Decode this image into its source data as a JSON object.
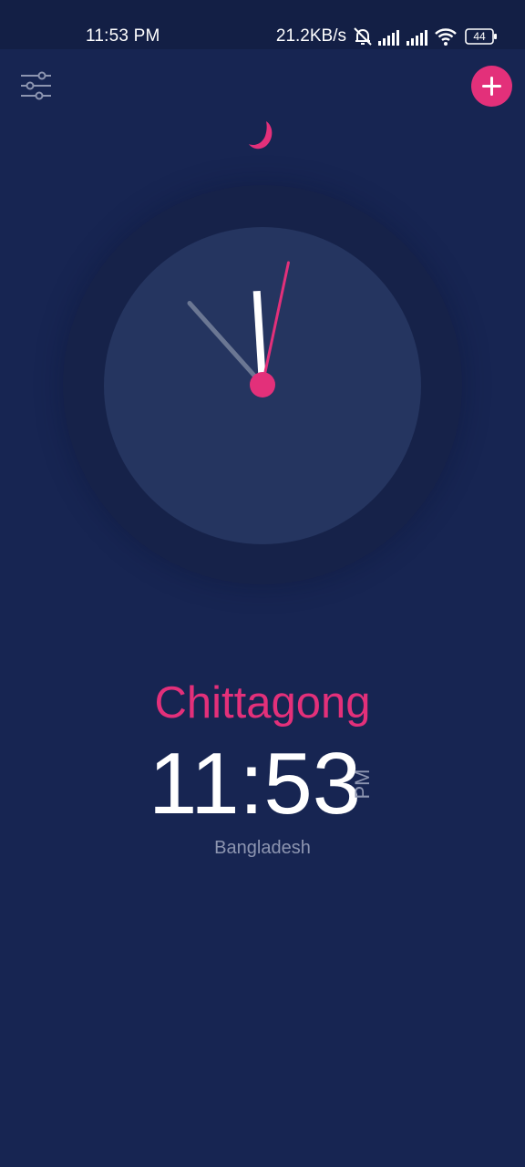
{
  "status_bar": {
    "time": "11:53 PM",
    "net_speed": "21.2KB/s",
    "battery_level": "44"
  },
  "icons": {
    "settings": "sliders-icon",
    "add": "plus-icon",
    "night": "crescent-moon-icon"
  },
  "colors": {
    "background": "#172552",
    "accent": "#e3307a",
    "clock_face": "#253560",
    "muted_text": "#8d95b0"
  },
  "clock": {
    "hour": 11,
    "minute": 53,
    "second": 2
  },
  "city": {
    "name": "Chittagong",
    "time": "11:53",
    "meridiem": "PM",
    "country": "Bangladesh"
  }
}
